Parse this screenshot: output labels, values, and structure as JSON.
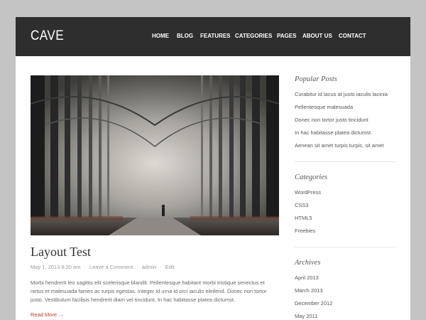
{
  "site": {
    "logo": "CAVE"
  },
  "nav": {
    "items": [
      {
        "label": "HOME"
      },
      {
        "label": "BLOG"
      },
      {
        "label": "FEATURES"
      },
      {
        "label": "CATEGORIES"
      },
      {
        "label": "PAGES"
      },
      {
        "label": "ABOUT US"
      },
      {
        "label": "CONTACT"
      }
    ]
  },
  "post": {
    "title": "Layout Test",
    "date": "May 1, 2013 8:20 am",
    "comments": "Leave a Comment",
    "author": "admin",
    "edit": "Edit",
    "excerpt": "Morbi hendrerit leo sagittis elit scelerisque blandit. Pellentesque habitant morbi tristique senectus et netus et malesuada fames ac turpis egestas. Integer id urna id orci iaculis eleifend. Donec non tortor justo. Vestibulum facilisis hendrerit diam vel tincidunt. In hac habitasse platea dictumst.",
    "read_more": "Read More →"
  },
  "sidebar": {
    "popular": {
      "title": "Popular Posts",
      "items": [
        "Curabitur id lacus at justo iaculis lacinia",
        "Pellentesque malesuada",
        "Donec non tortor justo tincidunt",
        "In hac habitasse platea dictumst.",
        "Aenean sit amet turpis turpis, sit amet"
      ]
    },
    "categories": {
      "title": "Categories",
      "items": [
        "WordPress",
        "CSS3",
        "HTML5",
        "Freebies"
      ]
    },
    "archives": {
      "title": "Archives",
      "items": [
        "April 2013",
        "March 2013",
        "December 2012",
        "May 2011"
      ]
    }
  },
  "colors": {
    "page_bg": "#c4c4c4",
    "header_bg": "#2e2e2e",
    "read_more": "#c0392b"
  }
}
